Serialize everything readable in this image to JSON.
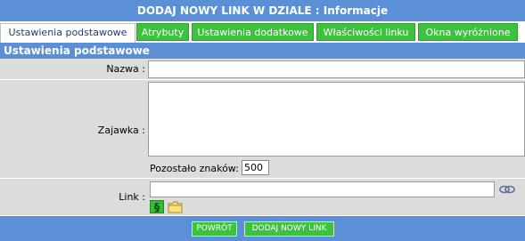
{
  "window": {
    "title": "DODAJ NOWY LINK W DZIALE : Informacje"
  },
  "tabs": [
    {
      "label": "Ustawienia podstawowe",
      "active": true
    },
    {
      "label": "Atrybuty",
      "active": false
    },
    {
      "label": "Ustawienia dodatkowe",
      "active": false
    },
    {
      "label": "Właściwości linku",
      "active": false
    },
    {
      "label": "Okna wyróżnione",
      "active": false
    }
  ],
  "section": {
    "title": "Ustawienia podstawowe"
  },
  "form": {
    "name_label": "Nazwa :",
    "name_value": "",
    "teaser_label": "Zajawka :",
    "teaser_value": "",
    "remaining_label": "Pozostało znaków:",
    "remaining_value": "500",
    "link_label": "Link :",
    "link_value": "",
    "section_icon_glyph": "§"
  },
  "buttons": {
    "back": "POWRÓT",
    "add": "DODAJ NOWY LINK"
  },
  "colors": {
    "header_blue": "#5b8fd6",
    "tab_green": "#3cc23c",
    "form_gray": "#dcdcdc"
  },
  "icons": {
    "section": "section-sign-icon",
    "folder": "folder-icon",
    "link": "link-icon"
  }
}
